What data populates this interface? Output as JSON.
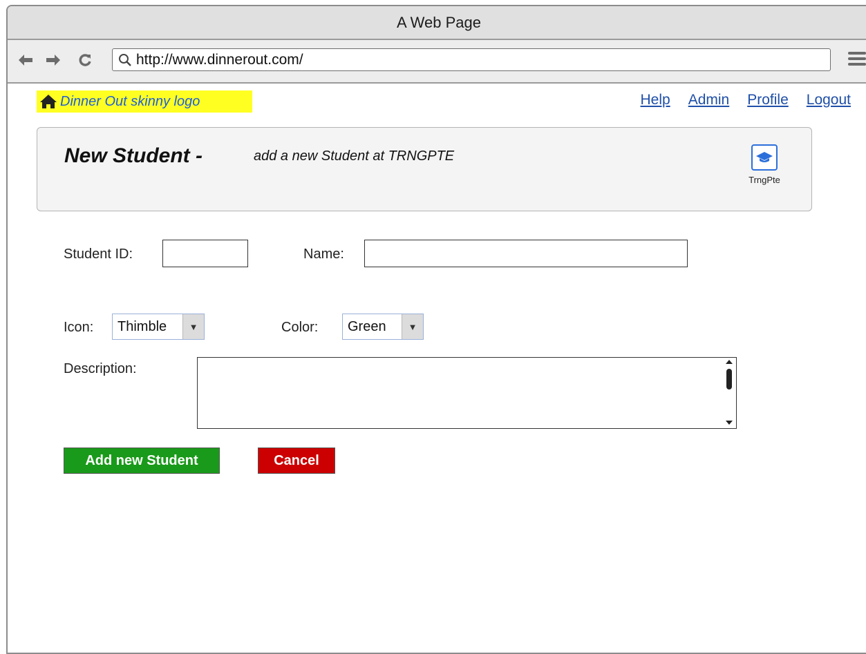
{
  "browser": {
    "window_title": "A Web Page",
    "url": "http://www.dinnerout.com/",
    "back_icon": "arrow-left-icon",
    "forward_icon": "arrow-right-icon",
    "reload_icon": "reload-icon",
    "search_icon": "search-icon",
    "menu_icon": "hamburger-menu-icon"
  },
  "site": {
    "logo_text": "Dinner Out skinny logo",
    "logo_icon": "home-icon",
    "logo_bg": "#ffff22",
    "links": [
      {
        "label": "Help"
      },
      {
        "label": "Admin"
      },
      {
        "label": "Profile"
      },
      {
        "label": "Logout"
      }
    ]
  },
  "header": {
    "title": "New Student -",
    "subtitle": "add a new Student at TRNGPTE",
    "org_icon": "graduation-cap-icon",
    "org_label": "TrngPte"
  },
  "form": {
    "student_id_label": "Student ID:",
    "student_id_value": "",
    "name_label": "Name:",
    "name_value": "",
    "icon_label": "Icon:",
    "icon_value": "Thimble",
    "color_label": "Color:",
    "color_value": "Green",
    "description_label": "Description:",
    "description_value": ""
  },
  "actions": {
    "add_label": "Add new Student",
    "add_color": "#1a9a1a",
    "cancel_label": "Cancel",
    "cancel_color": "#cc0000"
  }
}
